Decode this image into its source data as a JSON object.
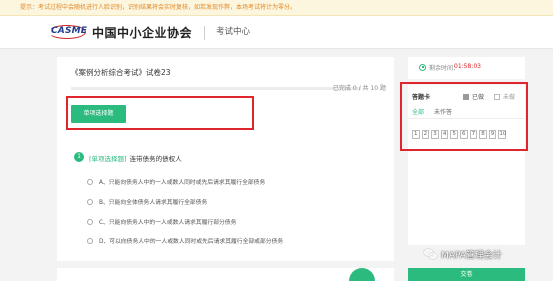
{
  "notice": "提示：考试过程中会随机进行人脸识别，识别结果将会实时复核，如若发现作弊，本场考试将计为零分。",
  "header": {
    "logo_mark": "CASME",
    "logo_title": "中国中小企业协会",
    "subtitle": "考试中心"
  },
  "paper": {
    "title": "《案例分析综合考试》试卷23",
    "progress_done": 0,
    "progress_total": 10,
    "progress_label_prefix": "已完成",
    "progress_label_sep": "/ 共",
    "progress_label_suffix": "题",
    "question_type_button": "单项选择题"
  },
  "question": {
    "number": "1",
    "type_tag": "[单项选择题]",
    "text": "连带债务的债权人",
    "options": [
      "A、只能向债务人中的一人或数人同时或先后请求其履行全部债务",
      "B、只能向全体债务人请求其履行全部债务",
      "C、只能向债务人中的一人或数人请求其履行部分债务",
      "D、可以向债务人中的一人或数人同时或先后请求其履行全部或部分债务"
    ]
  },
  "timer": {
    "label": "剩余时间：",
    "value": "01:58:03"
  },
  "answer_card": {
    "title": "答题卡",
    "legend_done": "已做",
    "legend_undone": "未做",
    "tabs": [
      "全部",
      "未作答"
    ],
    "numbers": [
      "1",
      "2",
      "3",
      "4",
      "5",
      "6",
      "7",
      "8",
      "9",
      "10"
    ]
  },
  "submit_label": "交卷",
  "watermark": "MAPA管理会计",
  "colors": {
    "accent": "#2cbb7f",
    "highlight_red": "#e0262d",
    "notice_bg": "#fdf6de",
    "notice_text": "#e08a2b"
  }
}
